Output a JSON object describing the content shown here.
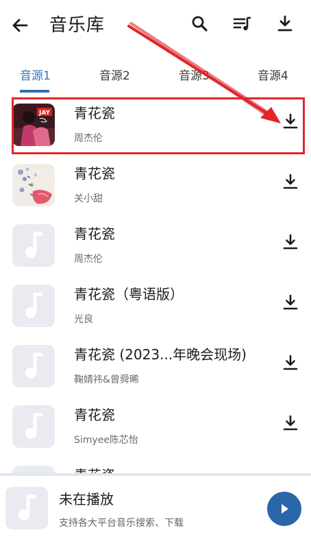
{
  "header": {
    "title": "音乐库",
    "back_icon": "arrow-left-icon",
    "actions": [
      "search-icon",
      "queue-music-icon",
      "download-icon"
    ]
  },
  "tabs": [
    {
      "label": "音源1",
      "active": true
    },
    {
      "label": "音源2",
      "active": false
    },
    {
      "label": "音源3",
      "active": false
    },
    {
      "label": "音源4",
      "active": false
    }
  ],
  "songs": [
    {
      "title": "青花瓷",
      "artist": "周杰伦",
      "cover": "jay-album-art",
      "highlighted": true
    },
    {
      "title": "青花瓷",
      "artist": "关小甜",
      "cover": "floral-album-art",
      "highlighted": false
    },
    {
      "title": "青花瓷",
      "artist": "周杰伦",
      "cover": "music-note-icon",
      "highlighted": false
    },
    {
      "title": "青花瓷（粤语版）",
      "artist": "光良",
      "cover": "music-note-icon",
      "highlighted": false
    },
    {
      "title": "青花瓷 (2023...年晚会现场)",
      "artist": "鞠婧祎&曾舜晞",
      "cover": "music-note-icon",
      "highlighted": false
    },
    {
      "title": "青花瓷",
      "artist": "Simyee陈芯怡",
      "cover": "music-note-icon",
      "highlighted": false
    },
    {
      "title": "青花瓷",
      "artist": "",
      "cover": "music-note-icon",
      "highlighted": false
    }
  ],
  "player": {
    "title": "未在播放",
    "subtitle": "支持各大平台音乐搜索、下载",
    "play_icon": "play-icon"
  },
  "cover_text": "JAY",
  "colors": {
    "accent": "#2f74c0",
    "highlight": "#e0262b",
    "play_button": "#2967a9"
  }
}
